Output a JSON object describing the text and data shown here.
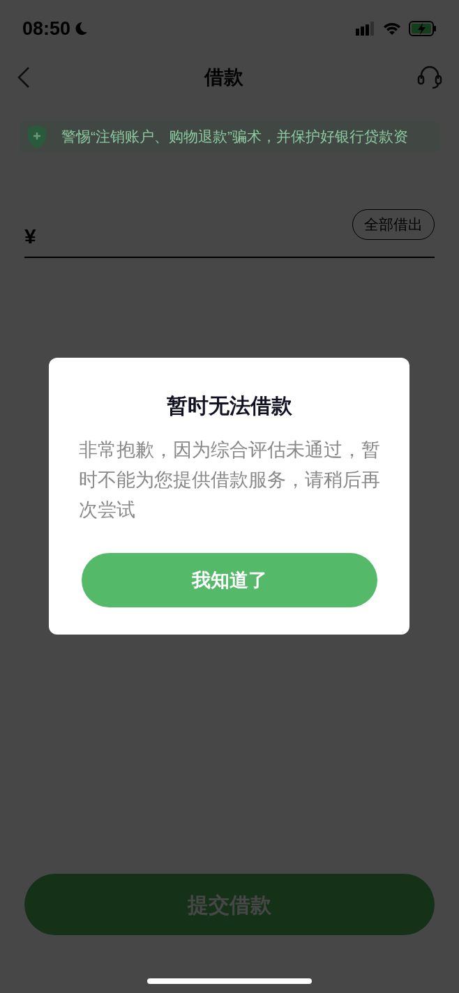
{
  "status_bar": {
    "time": "08:50"
  },
  "nav": {
    "title": "借款"
  },
  "banner": {
    "text": "警惕“注销账户、购物退款”骗术，并保护好银行贷款资"
  },
  "amount": {
    "currency": "¥",
    "all_button": "全部借出"
  },
  "submit_button": "提交借款",
  "dialog": {
    "title": "暂时无法借款",
    "message": "非常抱歉，因为综合评估未通过，暂时不能为您提供借款服务，请稍后再次尝试",
    "button": "我知道了"
  }
}
